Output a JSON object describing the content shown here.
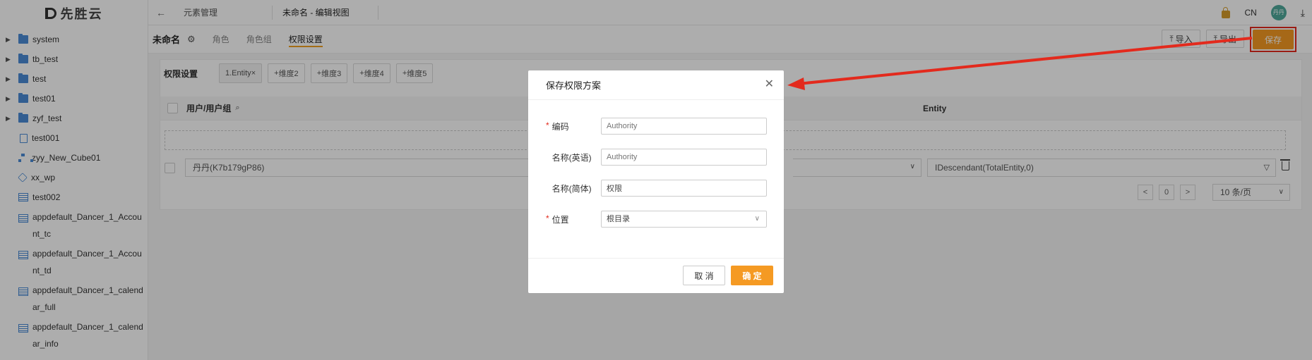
{
  "app": {
    "logo_text": "先胜云"
  },
  "sidebar": {
    "items": [
      {
        "label": "system",
        "icon": "folder-icon",
        "expandable": true
      },
      {
        "label": "tb_test",
        "icon": "folder-icon",
        "expandable": true
      },
      {
        "label": "test",
        "icon": "folder-icon",
        "expandable": true
      },
      {
        "label": "test01",
        "icon": "folder-icon",
        "expandable": true
      },
      {
        "label": "zyf_test",
        "icon": "folder-icon",
        "expandable": true
      },
      {
        "label": "test001",
        "icon": "doc-icon",
        "expandable": false
      },
      {
        "label": "zyy_New_Cube01",
        "icon": "tree-icon",
        "expandable": false
      },
      {
        "label": "xx_wp",
        "icon": "cube-icon",
        "expandable": false
      },
      {
        "label": "test002",
        "icon": "table-icon",
        "expandable": false
      },
      {
        "label": "appdefault_Dancer_1_Account_tc",
        "icon": "table-icon",
        "expandable": false
      },
      {
        "label": "appdefault_Dancer_1_Account_td",
        "icon": "table-icon",
        "expandable": false
      },
      {
        "label": "appdefault_Dancer_1_calendar_full",
        "icon": "table-icon",
        "expandable": false
      },
      {
        "label": "appdefault_Dancer_1_calendar_info",
        "icon": "table-icon",
        "expandable": false
      }
    ]
  },
  "topbar": {
    "tabs": [
      "元素管理",
      "未命名 - 编辑视图"
    ],
    "lang": "CN",
    "avatar_text": "丹丹"
  },
  "subheader": {
    "title": "未命名",
    "tabs": [
      "角色",
      "角色组",
      "权限设置"
    ],
    "active_tab": "权限设置",
    "import_label": "导入",
    "export_label": "导出",
    "save_label": "保存"
  },
  "content": {
    "section_title": "权限设置",
    "dimensions": [
      "1.Entity",
      "维度2",
      "维度3",
      "维度4",
      "维度5"
    ],
    "col_user": "用户/用户组",
    "col_entity": "Entity",
    "row": {
      "user": "丹丹(K7b179gP86)",
      "entity_value": "IDescendant(TotalEntity,0)"
    },
    "pager": {
      "page": "0",
      "page_size": "10 条/页"
    }
  },
  "modal": {
    "title": "保存权限方案",
    "fields": [
      {
        "label": "编码",
        "required": true,
        "value": "",
        "placeholder": "Authority"
      },
      {
        "label": "名称(英语)",
        "required": false,
        "value": "",
        "placeholder": "Authority"
      },
      {
        "label": "名称(简体)",
        "required": false,
        "value": "权限",
        "placeholder": ""
      },
      {
        "label": "位置",
        "required": true,
        "value": "根目录",
        "placeholder": ""
      }
    ],
    "cancel_label": "取 消",
    "ok_label": "确 定"
  },
  "colors": {
    "accent": "#f59a23",
    "annotation": "#e32a1d",
    "folder": "#4a8bd6"
  }
}
